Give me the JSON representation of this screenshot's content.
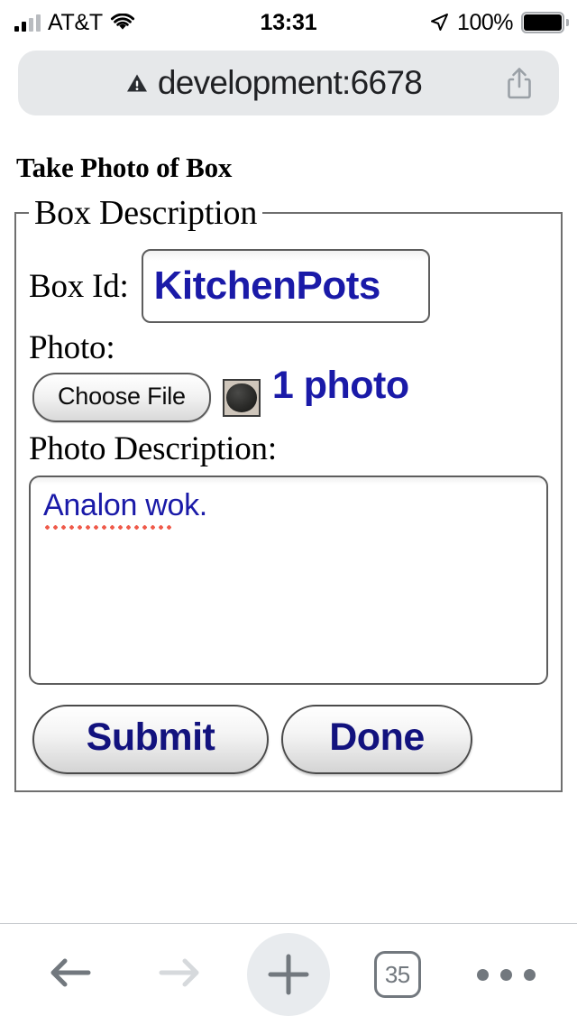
{
  "status_bar": {
    "carrier": "AT&T",
    "time": "13:31",
    "battery_percent": "100%",
    "signal_icon": "cellular-signal-icon",
    "wifi_icon": "wifi-icon",
    "location_icon": "location-arrow-icon",
    "battery_icon": "battery-full-icon"
  },
  "browser": {
    "url": "development:6678",
    "url_warning_icon": "insecure-warning-icon",
    "share_icon": "share-icon",
    "toolbar": {
      "back_icon": "back-arrow-icon",
      "forward_icon": "forward-arrow-icon",
      "new_tab_icon": "plus-icon",
      "tab_count": "35",
      "more_icon": "more-dots-icon"
    }
  },
  "page": {
    "title": "Take Photo of Box",
    "fieldset_legend": "Box Description",
    "box_id": {
      "label": "Box Id:",
      "value": "KitchenPots"
    },
    "photo": {
      "label": "Photo:",
      "choose_file_label": "Choose File",
      "thumbnail_name": "wok-photo-thumbnail",
      "count_text": "1 photo"
    },
    "photo_description": {
      "label": "Photo Description:",
      "value": "Analon wok."
    },
    "buttons": {
      "submit": "Submit",
      "done": "Done"
    }
  },
  "colors": {
    "link_blue": "#1a1aa8",
    "button_text": "#12127e",
    "spellcheck_red": "#ef5a4a",
    "toolbar_gray": "#72787e",
    "urlbar_bg": "#e6e8ea"
  }
}
